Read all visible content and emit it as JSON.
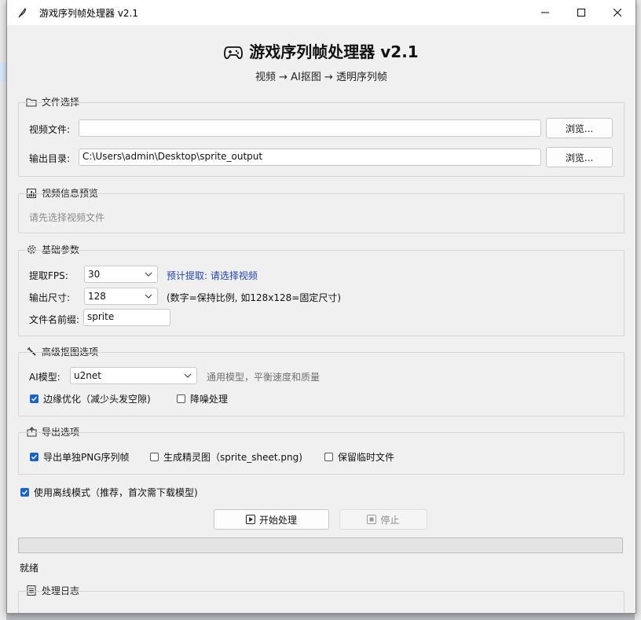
{
  "window": {
    "title": "游戏序列帧处理器 v2.1"
  },
  "header": {
    "title": "游戏序列帧处理器 v2.1",
    "subtitle": "视频 → AI抠图 → 透明序列帧"
  },
  "file_section": {
    "label": "文件选择",
    "video_label": "视频文件:",
    "video_value": "",
    "output_label": "输出目录:",
    "output_value": "C:\\Users\\admin\\Desktop\\sprite_output",
    "browse_label": "浏览..."
  },
  "preview_section": {
    "label": "视频信息预览",
    "placeholder": "请先选择视频文件"
  },
  "basic_section": {
    "label": "基础参数",
    "fps_label": "提取FPS:",
    "fps_value": "30",
    "fps_hint": "预计提取: 请选择视频",
    "size_label": "输出尺寸:",
    "size_value": "128",
    "size_hint": "(数字=保持比例, 如128x128=固定尺寸)",
    "prefix_label": "文件名前缀:",
    "prefix_value": "sprite"
  },
  "advanced_section": {
    "label": "高级抠图选项",
    "model_label": "AI模型:",
    "model_value": "u2net",
    "model_hint": "通用模型，平衡速度和质量",
    "edge_label": "边缘优化（减少头发空隙)",
    "edge_checked": true,
    "denoise_label": "降噪处理",
    "denoise_checked": false
  },
  "export_section": {
    "label": "导出选项",
    "png_label": "导出单独PNG序列帧",
    "png_checked": true,
    "sheet_label": "生成精灵图（sprite_sheet.png)",
    "sheet_checked": false,
    "temp_label": "保留临时文件",
    "temp_checked": false
  },
  "offline": {
    "label": "使用离线模式（推荐，首次需下载模型)",
    "checked": true
  },
  "actions": {
    "start_label": "开始处理",
    "stop_label": "停止"
  },
  "progress": {
    "value": 0
  },
  "status": {
    "text": "就绪"
  },
  "log_section": {
    "label": "处理日志"
  },
  "colors": {
    "accent": "#1a64c8",
    "hint_blue": "#1f3fb3"
  }
}
